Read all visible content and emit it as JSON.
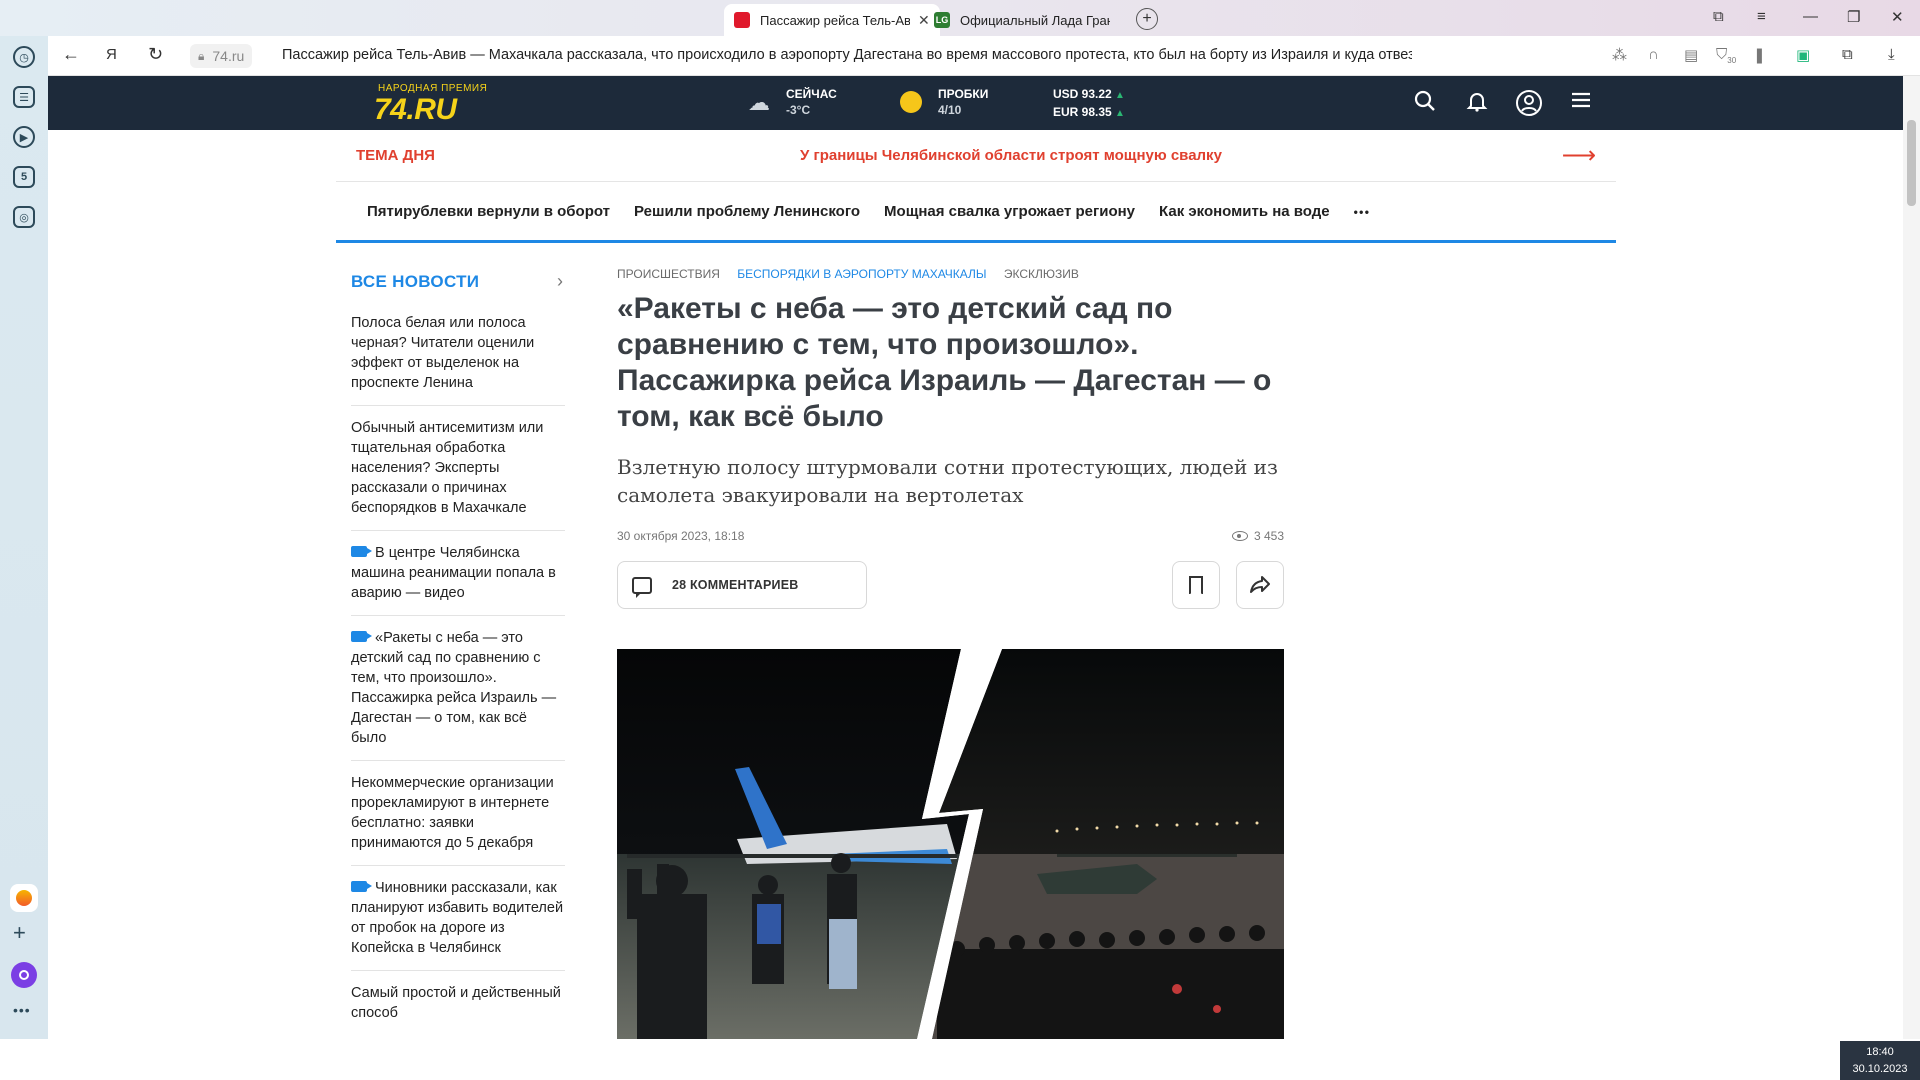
{
  "browser": {
    "tabs": [
      {
        "label": "Пассажир рейса Тель-Авив",
        "active": true,
        "favicon_color": "#e0192c"
      },
      {
        "label": "Официальный Лада Грант",
        "active": false,
        "favicon_color": "#2e7d32",
        "favicon_text": "LG"
      }
    ],
    "url": "74.ru",
    "page_title": "Пассажир рейса Тель-Авив — Махачкала рассказала, что происходило в аэропорту Дагестана во время массового протеста, кто был на борту из Израиля и куда отвезли пас...",
    "toolbar_badge": "30"
  },
  "site": {
    "logo_small": "НАРОДНАЯ ПРЕМИЯ",
    "logo_main": "74.RU",
    "brand_color": "#1d2a3a",
    "accent_color": "#1e88e5",
    "weather": {
      "label": "СЕЙЧАС",
      "value": "-3°C"
    },
    "traffic": {
      "label": "ПРОБКИ",
      "value": "4/10"
    },
    "currency": {
      "usd": "USD 93.22",
      "eur": "EUR 98.35"
    },
    "topic_label": "ТЕМА ДНЯ",
    "topic_link": "У границы Челябинской области строят мощную свалку",
    "subnav": [
      "Пятирублевки вернули в оборот",
      "Решили проблему Ленинского",
      "Мощная свалка угрожает региону",
      "Как экономить на воде"
    ],
    "subnav_more": "• • •"
  },
  "sidebar": {
    "title": "ВСЕ НОВОСТИ",
    "items": [
      {
        "text": "Полоса белая или полоса черная? Читатели оценили эффект от выделенок на проспекте Ленина",
        "video": false
      },
      {
        "text": "Обычный антисемитизм или тщательная обработка населения? Эксперты рассказали о причинах беспорядков в Махачкале",
        "video": false
      },
      {
        "text": "В центре Челябинска машина реанимации попала в аварию — видео",
        "video": true
      },
      {
        "text": "«Ракеты с неба — это детский сад по сравнению с тем, что произошло». Пассажирка рейса Израиль — Дагестан — о том, как всё было",
        "video": true
      },
      {
        "text": "Некоммерческие организации прорекламируют в интернете бесплатно: заявки принимаются до 5 декабря",
        "video": false
      },
      {
        "text": "Чиновники рассказали, как планируют избавить водителей от пробок на дороге из Копейска в Челябинск",
        "video": true
      },
      {
        "text": "Самый простой и действенный способ",
        "video": false
      }
    ]
  },
  "article": {
    "rubrics": [
      "ПРОИСШЕСТВИЯ",
      "БЕСПОРЯДКИ В АЭРОПОРТУ МАХАЧКАЛЫ",
      "ЭКСКЛЮЗИВ"
    ],
    "title": "«Ракеты с неба — это детский сад по сравнению с тем, что произошло». Пассажирка рейса Израиль — Дагестан — о том, как всё было",
    "lead": "Взлетную полосу штурмовали сотни протестующих, людей из самолета эвакуировали на вертолетах",
    "date": "30 октября 2023, 18:18",
    "views": "3 453",
    "comments_label": "28 КОММЕНТАРИЕВ"
  },
  "taskbar": {
    "time": "18:40",
    "date": "30.10.2023"
  }
}
